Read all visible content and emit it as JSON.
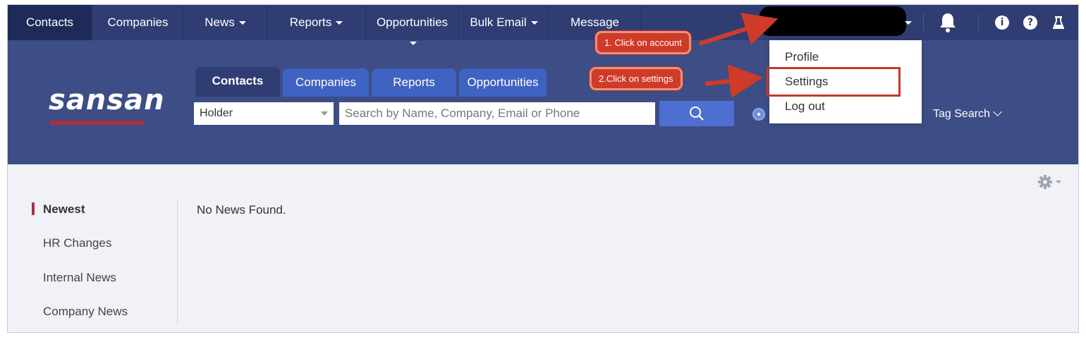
{
  "topnav": {
    "items": [
      {
        "label": "Contacts",
        "caret": false
      },
      {
        "label": "Companies",
        "caret": false
      },
      {
        "label": "News",
        "caret": true
      },
      {
        "label": "Reports",
        "caret": true
      },
      {
        "label": "Opportunities",
        "caret": false
      },
      {
        "label": "Bulk Email",
        "caret": true
      },
      {
        "label": "Message",
        "caret": false
      }
    ],
    "icons": [
      "bell-icon",
      "info-icon",
      "help-icon",
      "flask-icon"
    ]
  },
  "account_menu": {
    "items": [
      "Profile",
      "Settings",
      "Log out"
    ]
  },
  "header": {
    "logo": "sansan",
    "tabs": [
      "Contacts",
      "Companies",
      "Reports",
      "Opportunities"
    ],
    "select_value": "Holder",
    "search_placeholder": "Search by Name, Company, Email or Phone",
    "tag_search": "Tag Search"
  },
  "sidebar": {
    "items": [
      "Newest",
      "HR Changes",
      "Internal News",
      "Company News"
    ]
  },
  "main": {
    "empty_message": "No News Found."
  },
  "annotations": {
    "step1": "1. Click on account",
    "step2": "2.Click on settings"
  },
  "colors": {
    "nav": "#2f3d73",
    "header": "#3d4d85",
    "accent": "#a9303d",
    "annotation": "#cf3b28"
  }
}
